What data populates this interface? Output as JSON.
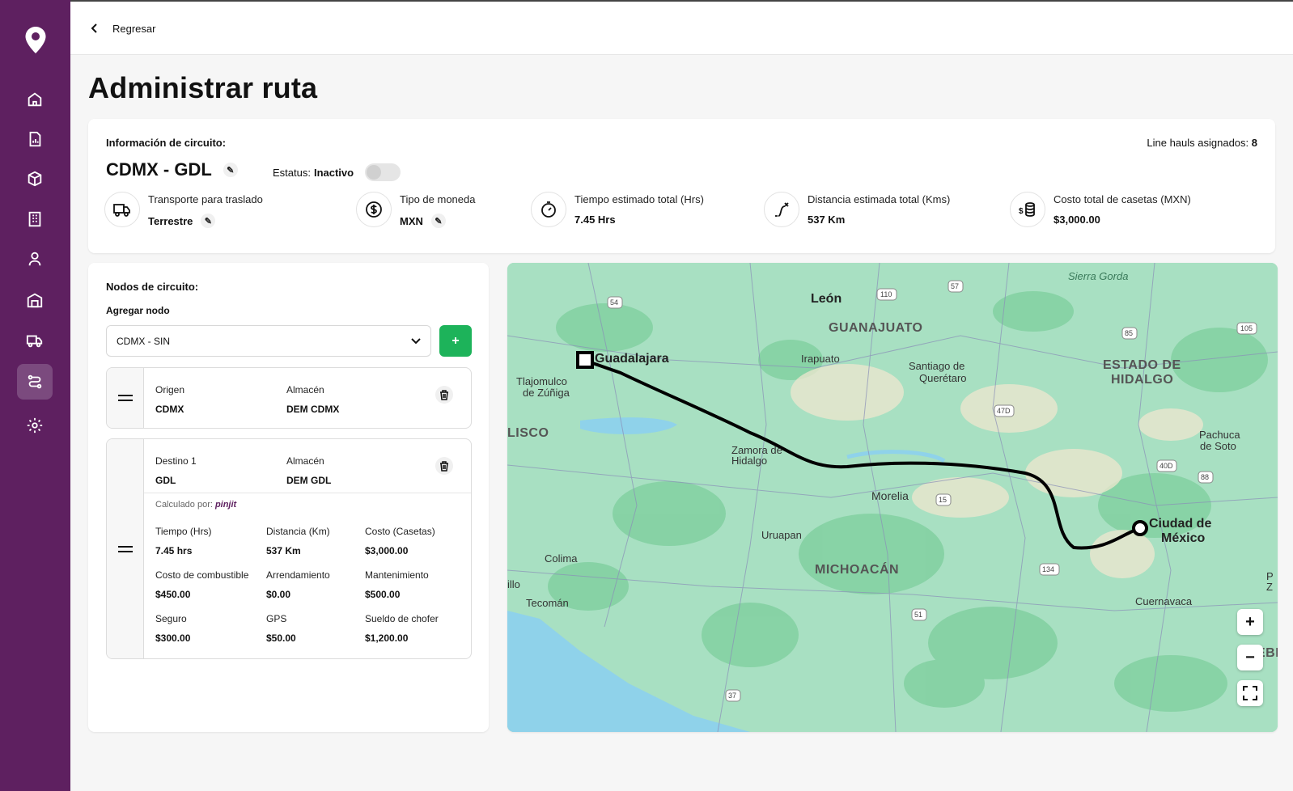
{
  "nav": {
    "back_label": "Regresar",
    "items": [
      "home-icon",
      "reports-icon",
      "box-icon",
      "building-icon",
      "user-icon",
      "warehouse-icon",
      "truck-icon",
      "route-icon",
      "gear-icon"
    ],
    "active": "route-icon"
  },
  "page": {
    "title": "Administrar ruta"
  },
  "circuit": {
    "label": "Información de circuito:",
    "name": "CDMX - GDL",
    "status_label": "Estatus:",
    "status_value": "Inactivo",
    "linehauls_label": "Line hauls asignados:",
    "linehauls_value": "8",
    "stats": [
      {
        "title": "Transporte para traslado",
        "value": "Terrestre",
        "icon": "truck-icon"
      },
      {
        "title": "Tipo de moneda",
        "value": "MXN",
        "icon": "dollar-icon"
      },
      {
        "title": "Tiempo estimado total (Hrs)",
        "value": "7.45 Hrs",
        "icon": "stopwatch-icon"
      },
      {
        "title": "Distancia estimada total (Kms)",
        "value": "537 Km",
        "icon": "distance-icon"
      },
      {
        "title": "Costo total de casetas (MXN)",
        "value": "$3,000.00",
        "icon": "coins-icon"
      }
    ]
  },
  "nodes": {
    "title": "Nodos de circuito:",
    "add_label": "Agregar nodo",
    "select_value": "CDMX - SIN",
    "add_button": "+",
    "origin": {
      "k1": "Origen",
      "v1": "CDMX",
      "k2": "Almacén",
      "v2": "DEM CDMX"
    },
    "dest": {
      "k1": "Destino 1",
      "v1": "GDL",
      "k2": "Almacén",
      "v2": "DEM GDL",
      "calc_label": "Calculado por:",
      "calc_brand": "pinjit",
      "fields": [
        {
          "k": "Tiempo (Hrs)",
          "v": "7.45 hrs"
        },
        {
          "k": "Distancia (Km)",
          "v": "537 Km"
        },
        {
          "k": "Costo (Casetas)",
          "v": "$3,000.00"
        },
        {
          "k": "Costo de combustible",
          "v": "$450.00"
        },
        {
          "k": "Arrendamiento",
          "v": "$0.00"
        },
        {
          "k": "Mantenimiento",
          "v": "$500.00"
        },
        {
          "k": "Seguro",
          "v": "$300.00"
        },
        {
          "k": "GPS",
          "v": "$50.00"
        },
        {
          "k": "Sueldo de chofer",
          "v": "$1,200.00"
        }
      ]
    }
  },
  "map": {
    "labels": {
      "sierra": "Sierra Gorda",
      "leon": "León",
      "guanajuato": "GUANAJUATO",
      "irapuato": "Irapuato",
      "santiago": "Santiago de",
      "queretaro": "Querétaro",
      "estado": "ESTADO DE",
      "hidalgo": "HIDALGO",
      "guadalajara": "Guadalajara",
      "tlajo": "Tlajomulco",
      "zuniga": "de Zúñiga",
      "lisco": "LISCO",
      "pachuca": "Pachuca",
      "desoto": "de Soto",
      "zamora": "Zamora de",
      "zhidalgo": "Hidalgo",
      "morelia": "Morelia",
      "ciudad": "Ciudad de",
      "mexico": "México",
      "uruapan": "Uruapan",
      "colima": "Colima",
      "michoacan": "MICHOACÁN",
      "illo": "illo",
      "tecoman": "Tecomán",
      "cuernavaca": "Cuernavaca",
      "ebl": "EBL",
      "pz1": "P",
      "pz2": "Z"
    },
    "roads": [
      "54",
      "110",
      "57",
      "85",
      "105",
      "47D",
      "40D",
      "88",
      "15",
      "134",
      "51",
      "37"
    ],
    "zoom_in": "+",
    "zoom_out": "−"
  }
}
